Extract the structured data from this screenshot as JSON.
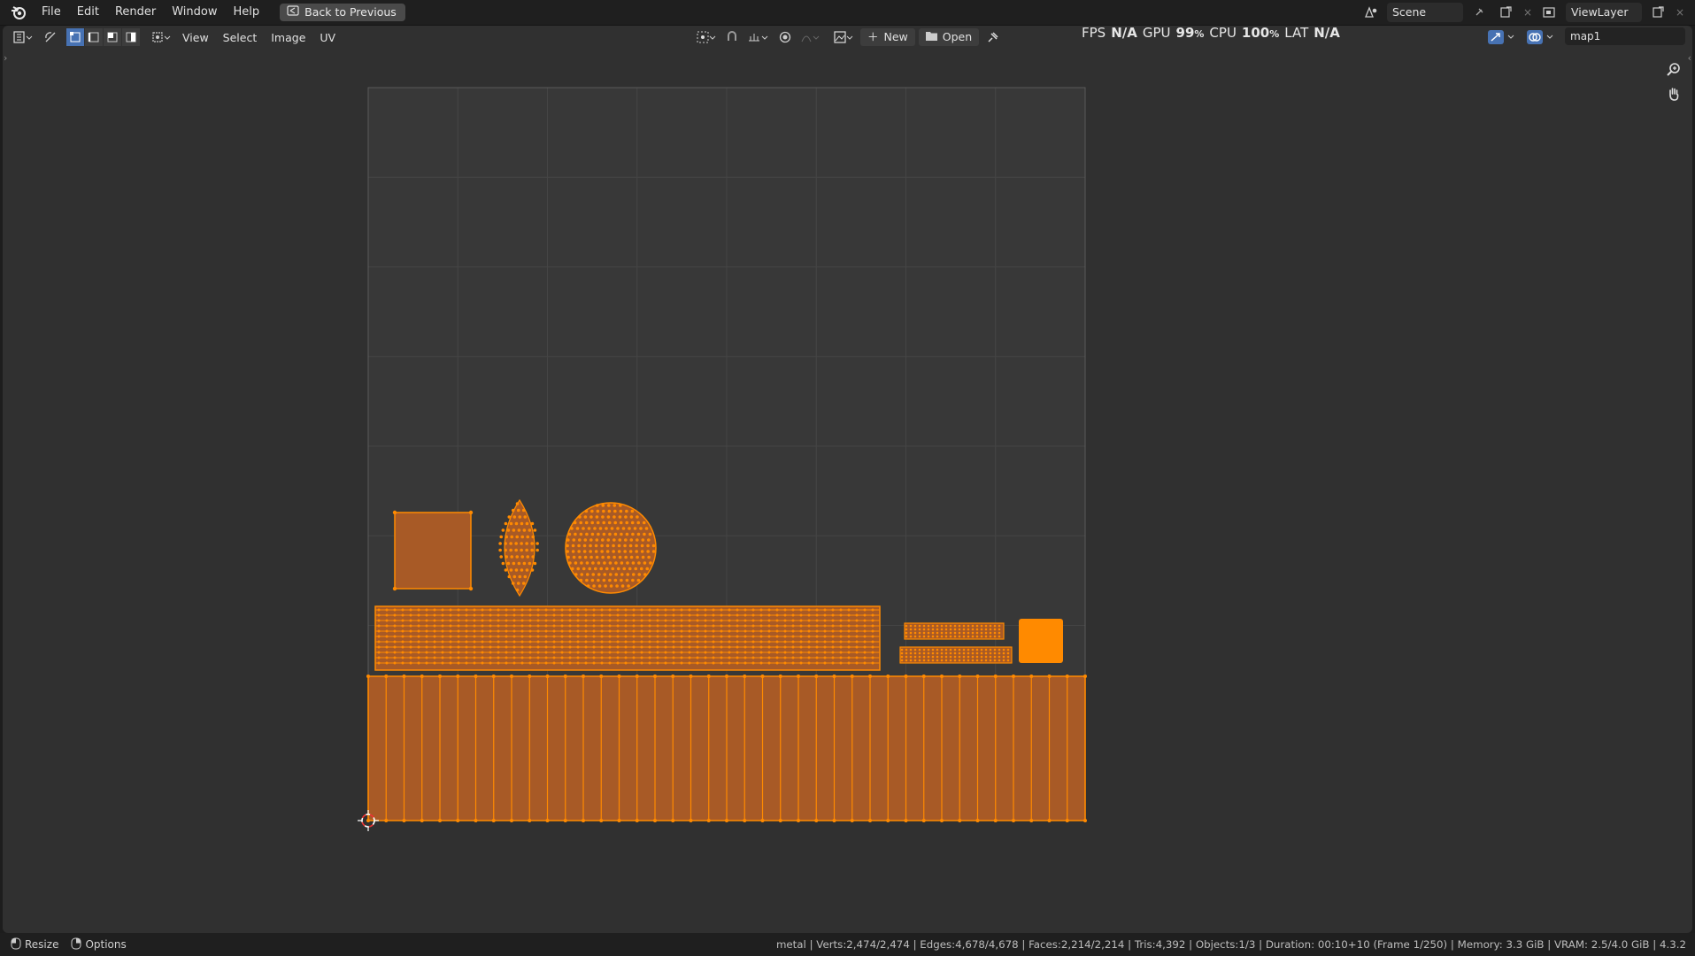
{
  "topbar": {
    "menus": [
      "File",
      "Edit",
      "Render",
      "Window",
      "Help"
    ],
    "back_button": "Back to Previous",
    "scene": "Scene",
    "view_layer": "ViewLayer"
  },
  "editor_header": {
    "menus": [
      "View",
      "Select",
      "Image",
      "UV"
    ],
    "new_label": "New",
    "open_label": "Open",
    "image_name": "map1"
  },
  "stats": {
    "fps_label": "FPS",
    "fps_value": "N/A",
    "gpu_label": "GPU",
    "gpu_value": "99",
    "cpu_label": "CPU",
    "cpu_value": "100",
    "pct": "%",
    "lat_label": "LAT",
    "lat_value": "N/A"
  },
  "statusbar": {
    "resize": "Resize",
    "options": "Options",
    "info": "metal | Verts:2,474/2,474 | Edges:4,678/4,678 | Faces:2,214/2,214 | Tris:4,392 | Objects:1/3 | Duration: 00:10+10 (Frame 1/250) | Memory: 3.3 GiB | VRAM: 2.5/4.0 GiB | 4.3.2"
  },
  "colors": {
    "uv_fill": "#a85a26",
    "uv_edge": "#ff8a00",
    "selected_face": "#ff8a00",
    "accent": "#4772b3"
  },
  "icons": [
    "blender-logo",
    "back-icon",
    "scene-icon",
    "pin-icon",
    "new-scene-icon",
    "view-layer-icon",
    "editor-type-icon",
    "sync-icon",
    "vertex-select-icon",
    "edge-select-icon",
    "face-select-icon",
    "island-select-icon",
    "pivot-icon",
    "snap-icon",
    "proportional-icon",
    "image-icon",
    "plus-icon",
    "folder-icon",
    "pin-icon",
    "gizmo-icon",
    "overlay-icon",
    "zoom-icon",
    "hand-icon",
    "cursor-icon",
    "mouse-icon"
  ]
}
